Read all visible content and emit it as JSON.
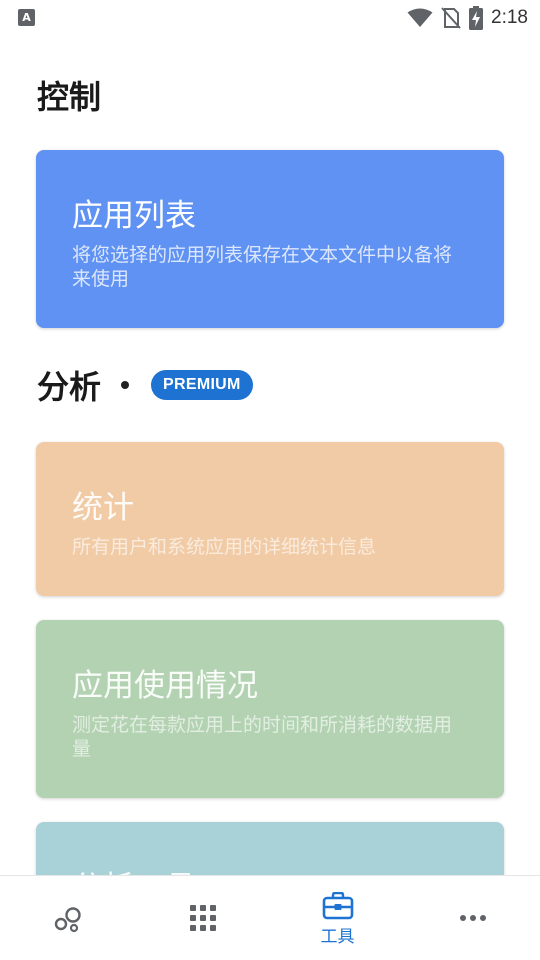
{
  "status_bar": {
    "time": "2:18",
    "left_icon_letter": "A",
    "icons": [
      "wifi-icon",
      "no-sim-icon",
      "battery-charging-icon"
    ]
  },
  "sections": {
    "control": {
      "title": "控制"
    },
    "analysis": {
      "title": "分析",
      "badge": "PREMIUM"
    }
  },
  "cards": {
    "app_list": {
      "title": "应用列表",
      "description": "将您选择的应用列表保存在文本文件中以备将来使用",
      "color": "#5f92f2"
    },
    "stats": {
      "title": "统计",
      "description": "所有用户和系统应用的详细统计信息",
      "color": "#f1cba6"
    },
    "usage": {
      "title": "应用使用情况",
      "description": "测定花在每款应用上的时间和所消耗的数据用量",
      "color": "#b2d2b2"
    },
    "tools": {
      "title": "分析工具",
      "color": "#a8d2d8"
    }
  },
  "bottom_nav": {
    "items": [
      {
        "icon": "bubbles-icon",
        "label": ""
      },
      {
        "icon": "apps-grid-icon",
        "label": ""
      },
      {
        "icon": "toolbox-icon",
        "label": "工具"
      },
      {
        "icon": "more-horizontal-icon",
        "label": ""
      }
    ],
    "active_color": "#1e73d2"
  }
}
